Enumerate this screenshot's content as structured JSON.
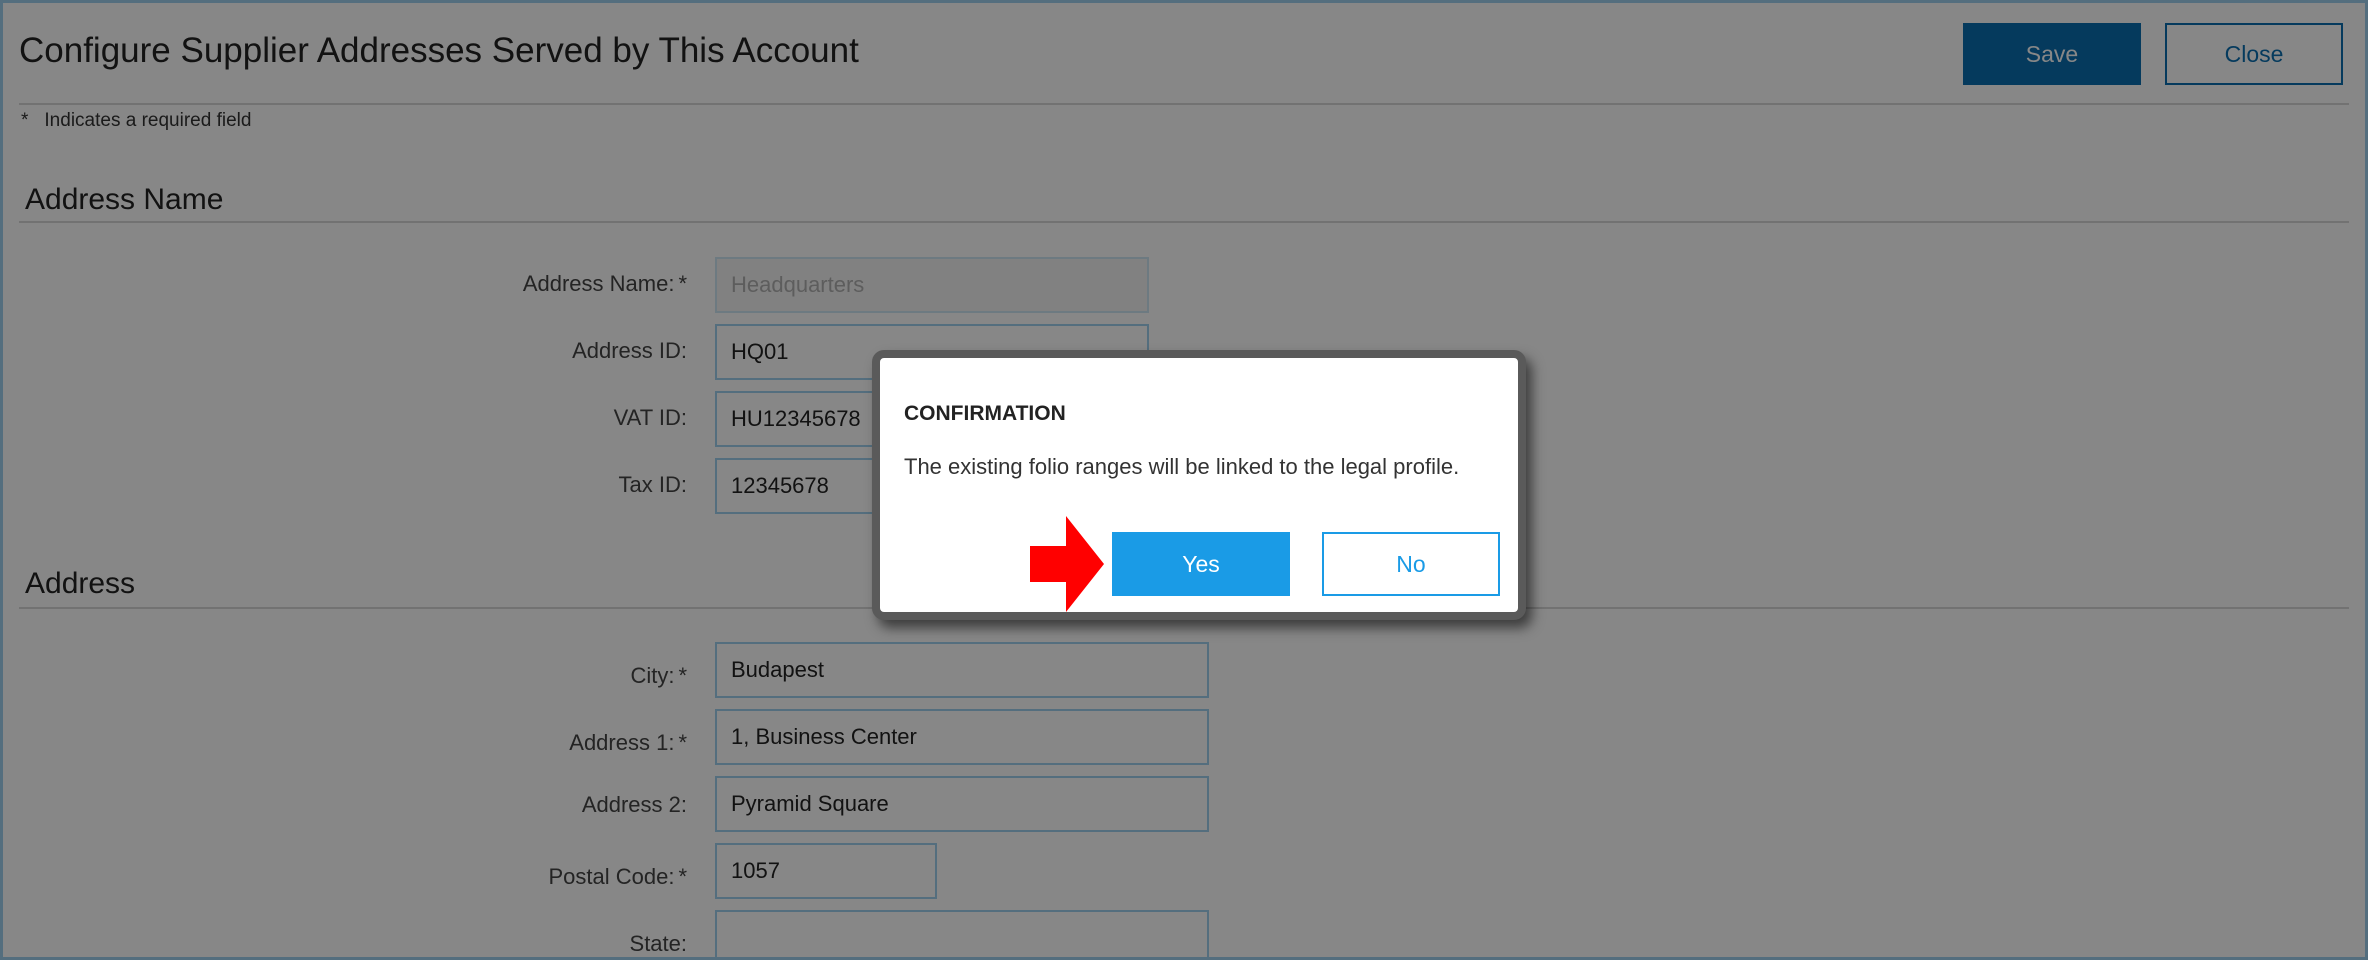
{
  "header": {
    "title": "Configure Supplier Addresses Served by This Account",
    "save_label": "Save",
    "close_label": "Close"
  },
  "required_note": {
    "star": "*",
    "text": "Indicates a required field"
  },
  "sections": {
    "address_name": {
      "heading": "Address Name",
      "fields": [
        {
          "label": "Address Name:",
          "required": "*",
          "value": "Headquarters",
          "disabled": true
        },
        {
          "label": "Address ID:",
          "required": "",
          "value": "HQ01"
        },
        {
          "label": "VAT ID:",
          "required": "",
          "value": "HU12345678"
        },
        {
          "label": "Tax ID:",
          "required": "",
          "value": "12345678"
        }
      ]
    },
    "address": {
      "heading": "Address",
      "fields": [
        {
          "label": "City:",
          "required": "*",
          "value": "Budapest"
        },
        {
          "label": "Address 1:",
          "required": "*",
          "value": "1, Business Center"
        },
        {
          "label": "Address 2:",
          "required": "",
          "value": "Pyramid Square"
        },
        {
          "label": "Postal Code:",
          "required": "*",
          "value": "1057"
        },
        {
          "label": "State:",
          "required": "",
          "value": ""
        }
      ]
    }
  },
  "dialog": {
    "title": "CONFIRMATION",
    "message": "The existing folio ranges will be linked to the legal profile.",
    "yes_label": "Yes",
    "no_label": "No"
  },
  "colors": {
    "primary": "#0a6fb0",
    "dialog_button": "#1a9be6",
    "field_border": "#9fd0ee",
    "arrow": "#ff0000",
    "overlay": "#8a8a8a"
  }
}
